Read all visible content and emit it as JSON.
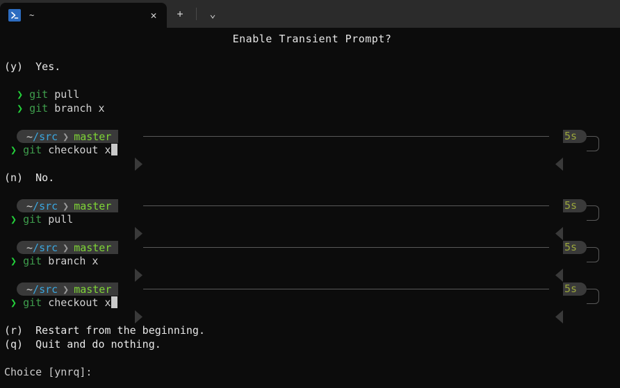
{
  "window": {
    "tab": {
      "icon": "powershell-icon",
      "title": "~",
      "close_label": "✕"
    },
    "new_tab_label": "+",
    "dropdown_label": "⌄"
  },
  "terminal": {
    "title": "Enable Transient Prompt?",
    "options": [
      {
        "key": "(y)",
        "text": "Yes."
      },
      {
        "key": "(n)",
        "text": "No."
      },
      {
        "key": "(r)",
        "text": "Restart from the beginning."
      },
      {
        "key": "(q)",
        "text": "Quit and do nothing."
      }
    ],
    "choice_prompt": "Choice [ynrq]:",
    "prompt": {
      "arrow": "❯",
      "path_tilde": "~",
      "path_sep": "/",
      "path_dir": "src",
      "segment_sep": "❯",
      "branch": "master",
      "duration": "5s"
    },
    "yes_section": {
      "plain_commands": [
        {
          "name": "git",
          "args": "pull"
        },
        {
          "name": "git",
          "args": "branch x"
        }
      ],
      "final_command": {
        "name": "git",
        "args": "checkout x"
      }
    },
    "no_section": {
      "blocks": [
        {
          "name": "git",
          "args": "pull"
        },
        {
          "name": "git",
          "args": "branch x"
        },
        {
          "name": "git",
          "args": "checkout x"
        }
      ]
    },
    "colors": {
      "background": "#0c0c0c",
      "titlebar": "#2b2b2b",
      "segment_bg": "#3a3a3a",
      "branch_green": "#7fd636",
      "path_blue": "#3aa7e0",
      "duration_olive": "#9aa63c",
      "prompt_green": "#23d13a",
      "command_green": "#3f9e4d",
      "text": "#d2d2d2",
      "line": "#5a5a5a"
    }
  }
}
